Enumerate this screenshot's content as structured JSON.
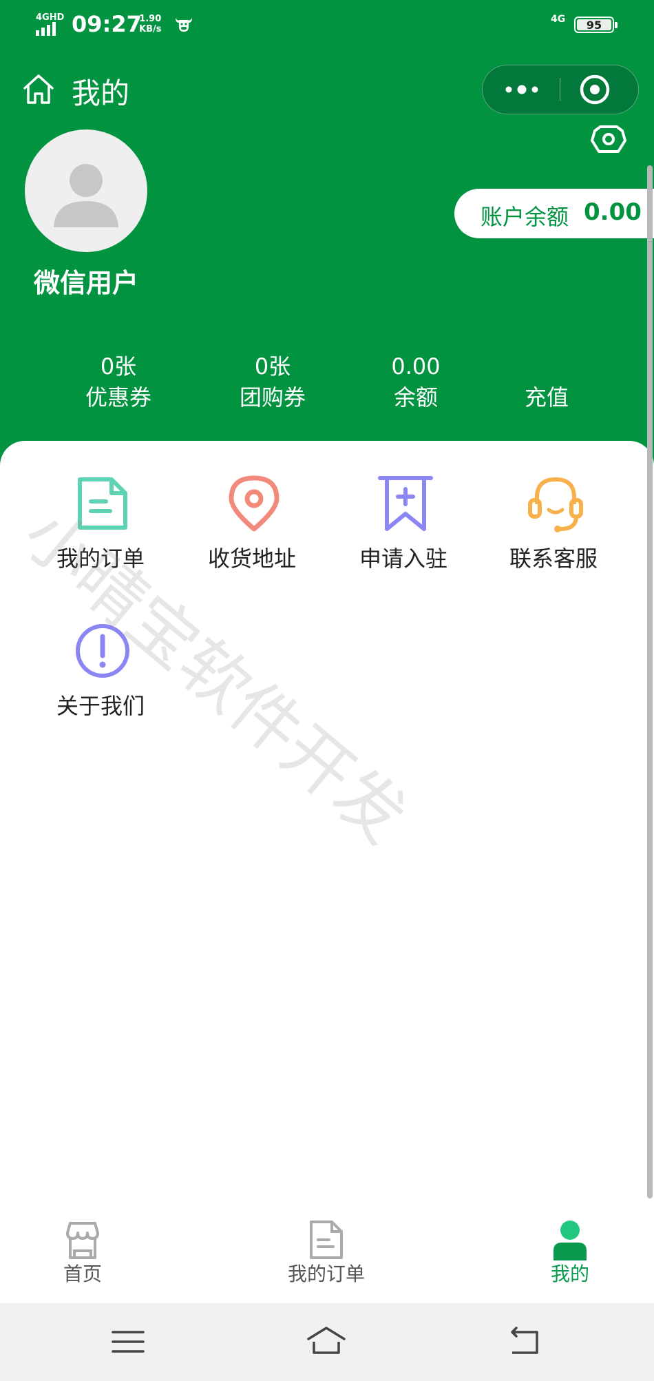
{
  "status_bar": {
    "network": "4GHD",
    "time": "09:27",
    "speed_value": "1.90",
    "speed_unit": "KB/s",
    "network_right": "4G",
    "battery": "95"
  },
  "nav": {
    "title": "我的"
  },
  "profile": {
    "username": "微信用户",
    "balance_label": "账户余额",
    "balance_value": "0.00"
  },
  "stats": [
    {
      "value": "0张",
      "label": "优惠券"
    },
    {
      "value": "0张",
      "label": "团购券"
    },
    {
      "value": "0.00",
      "label": "余额"
    },
    {
      "value": "",
      "label": "充值"
    }
  ],
  "menu": [
    {
      "label": "我的订单",
      "icon": "document-icon",
      "color": "#5ed3b4"
    },
    {
      "label": "收货地址",
      "icon": "location-pin-icon",
      "color": "#f28a7c"
    },
    {
      "label": "申请入驻",
      "icon": "bookmark-plus-icon",
      "color": "#8b86f2"
    },
    {
      "label": "联系客服",
      "icon": "headset-icon",
      "color": "#f7b04a"
    },
    {
      "label": "关于我们",
      "icon": "info-icon",
      "color": "#8b86f2"
    }
  ],
  "watermark": "小晴宝软件开发",
  "tabbar": [
    {
      "label": "首页",
      "icon": "store-icon"
    },
    {
      "label": "我的订单",
      "icon": "document-icon"
    },
    {
      "label": "我的",
      "icon": "person-icon"
    }
  ],
  "colors": {
    "brand_green": "#029341",
    "active_tab": "#0a9a4d"
  }
}
